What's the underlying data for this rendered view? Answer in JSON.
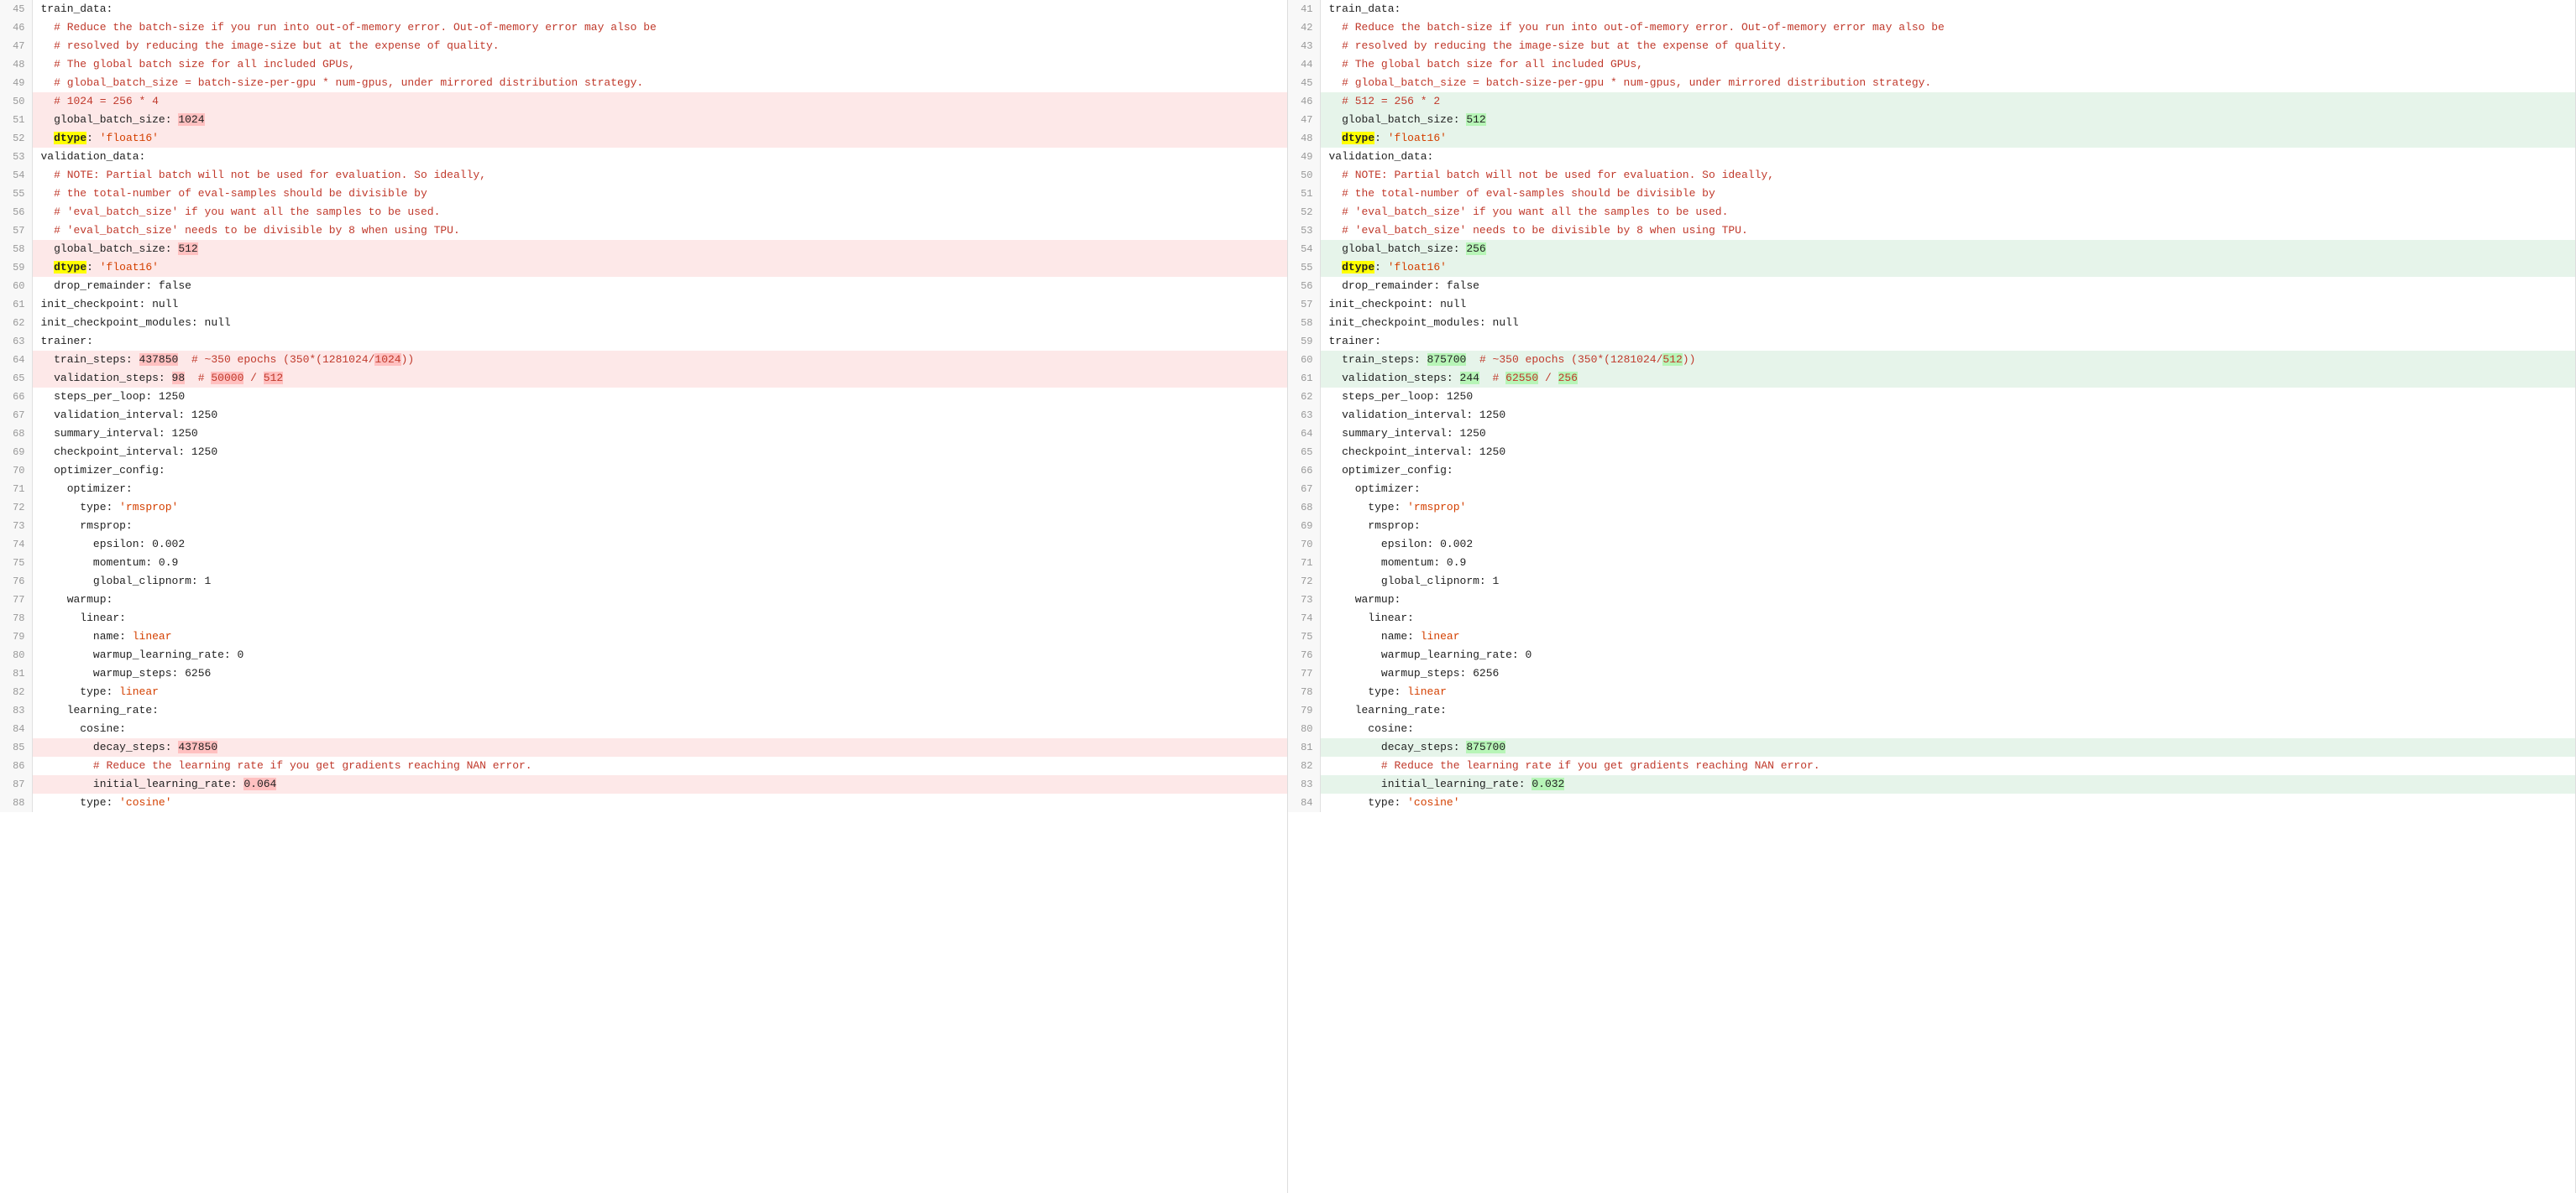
{
  "panes": [
    {
      "id": "left",
      "lines": [
        {
          "n": 45,
          "code": "train_data:",
          "bg": ""
        },
        {
          "n": 46,
          "code": "  # Reduce the batch-size if you run into out-of-memory error. Out-of-memory error may also be",
          "bg": ""
        },
        {
          "n": 47,
          "code": "  # resolved by reducing the image-size but at the expense of quality.",
          "bg": ""
        },
        {
          "n": 48,
          "code": "  # The global batch size for all included GPUs,",
          "bg": ""
        },
        {
          "n": 49,
          "code": "  # global_batch_size = batch-size-per-gpu * num-gpus, under mirrored distribution strategy.",
          "bg": ""
        },
        {
          "n": 50,
          "code": "  # 1024 = 256 * 4",
          "bg": "pink"
        },
        {
          "n": 51,
          "code": "  global_batch_size: 1024",
          "bg": "pink"
        },
        {
          "n": 52,
          "code": "  dtype: 'float16'",
          "bg": "pink"
        },
        {
          "n": 53,
          "code": "validation_data:",
          "bg": ""
        },
        {
          "n": 54,
          "code": "  # NOTE: Partial batch will not be used for evaluation. So ideally,",
          "bg": ""
        },
        {
          "n": 55,
          "code": "  # the total-number of eval-samples should be divisible by",
          "bg": ""
        },
        {
          "n": 56,
          "code": "  # 'eval_batch_size' if you want all the samples to be used.",
          "bg": ""
        },
        {
          "n": 57,
          "code": "  # 'eval_batch_size' needs to be divisible by 8 when using TPU.",
          "bg": ""
        },
        {
          "n": 58,
          "code": "  global_batch_size: 512",
          "bg": "pink"
        },
        {
          "n": 59,
          "code": "  dtype: 'float16'",
          "bg": "pink"
        },
        {
          "n": 60,
          "code": "  drop_remainder: false",
          "bg": ""
        },
        {
          "n": 61,
          "code": "init_checkpoint: null",
          "bg": ""
        },
        {
          "n": 62,
          "code": "init_checkpoint_modules: null",
          "bg": ""
        },
        {
          "n": 63,
          "code": "trainer:",
          "bg": ""
        },
        {
          "n": 64,
          "code": "  train_steps: 437850  # ~350 epochs (350*(1281024/1024))",
          "bg": "pink"
        },
        {
          "n": 65,
          "code": "  validation_steps: 98  # 50000 / 512",
          "bg": "pink"
        },
        {
          "n": 66,
          "code": "  steps_per_loop: 1250",
          "bg": ""
        },
        {
          "n": 67,
          "code": "  validation_interval: 1250",
          "bg": ""
        },
        {
          "n": 68,
          "code": "  summary_interval: 1250",
          "bg": ""
        },
        {
          "n": 69,
          "code": "  checkpoint_interval: 1250",
          "bg": ""
        },
        {
          "n": 70,
          "code": "  optimizer_config:",
          "bg": ""
        },
        {
          "n": 71,
          "code": "    optimizer:",
          "bg": ""
        },
        {
          "n": 72,
          "code": "      type: 'rmsprop'",
          "bg": ""
        },
        {
          "n": 73,
          "code": "      rmsprop:",
          "bg": ""
        },
        {
          "n": 74,
          "code": "        epsilon: 0.002",
          "bg": ""
        },
        {
          "n": 75,
          "code": "        momentum: 0.9",
          "bg": ""
        },
        {
          "n": 76,
          "code": "        global_clipnorm: 1",
          "bg": ""
        },
        {
          "n": 77,
          "code": "    warmup:",
          "bg": ""
        },
        {
          "n": 78,
          "code": "      linear:",
          "bg": ""
        },
        {
          "n": 79,
          "code": "        name: linear",
          "bg": ""
        },
        {
          "n": 80,
          "code": "        warmup_learning_rate: 0",
          "bg": ""
        },
        {
          "n": 81,
          "code": "        warmup_steps: 6256",
          "bg": ""
        },
        {
          "n": 82,
          "code": "      type: linear",
          "bg": ""
        },
        {
          "n": 83,
          "code": "    learning_rate:",
          "bg": ""
        },
        {
          "n": 84,
          "code": "      cosine:",
          "bg": ""
        },
        {
          "n": 85,
          "code": "        decay_steps: 437850",
          "bg": "pink"
        },
        {
          "n": 86,
          "code": "        # Reduce the learning rate if you get gradients reaching NAN error.",
          "bg": ""
        },
        {
          "n": 87,
          "code": "        initial_learning_rate: 0.064",
          "bg": "pink"
        },
        {
          "n": 88,
          "code": "      type: 'cosine'",
          "bg": ""
        }
      ]
    },
    {
      "id": "right",
      "lines": [
        {
          "n": 41,
          "code": "train_data:",
          "bg": ""
        },
        {
          "n": 42,
          "code": "  # Reduce the batch-size if you run into out-of-memory error. Out-of-memory error may also be",
          "bg": ""
        },
        {
          "n": 43,
          "code": "  # resolved by reducing the image-size but at the expense of quality.",
          "bg": ""
        },
        {
          "n": 44,
          "code": "  # The global batch size for all included GPUs,",
          "bg": ""
        },
        {
          "n": 45,
          "code": "  # global_batch_size = batch-size-per-gpu * num-gpus, under mirrored distribution strategy.",
          "bg": ""
        },
        {
          "n": 46,
          "code": "  # 512 = 256 * 2",
          "bg": "green"
        },
        {
          "n": 47,
          "code": "  global_batch_size: 512",
          "bg": "green"
        },
        {
          "n": 48,
          "code": "  dtype: 'float16'",
          "bg": "green"
        },
        {
          "n": 49,
          "code": "validation_data:",
          "bg": ""
        },
        {
          "n": 50,
          "code": "  # NOTE: Partial batch will not be used for evaluation. So ideally,",
          "bg": ""
        },
        {
          "n": 51,
          "code": "  # the total-number of eval-samples should be divisible by",
          "bg": ""
        },
        {
          "n": 52,
          "code": "  # 'eval_batch_size' if you want all the samples to be used.",
          "bg": ""
        },
        {
          "n": 53,
          "code": "  # 'eval_batch_size' needs to be divisible by 8 when using TPU.",
          "bg": ""
        },
        {
          "n": 54,
          "code": "  global_batch_size: 256",
          "bg": "green"
        },
        {
          "n": 55,
          "code": "  dtype: 'float16'",
          "bg": "green"
        },
        {
          "n": 56,
          "code": "  drop_remainder: false",
          "bg": ""
        },
        {
          "n": 57,
          "code": "init_checkpoint: null",
          "bg": ""
        },
        {
          "n": 58,
          "code": "init_checkpoint_modules: null",
          "bg": ""
        },
        {
          "n": 59,
          "code": "trainer:",
          "bg": ""
        },
        {
          "n": 60,
          "code": "  train_steps: 875700  # ~350 epochs (350*(1281024/512))",
          "bg": "green"
        },
        {
          "n": 61,
          "code": "  validation_steps: 244  # 62550 / 256",
          "bg": "green"
        },
        {
          "n": 62,
          "code": "  steps_per_loop: 1250",
          "bg": ""
        },
        {
          "n": 63,
          "code": "  validation_interval: 1250",
          "bg": ""
        },
        {
          "n": 64,
          "code": "  summary_interval: 1250",
          "bg": ""
        },
        {
          "n": 65,
          "code": "  checkpoint_interval: 1250",
          "bg": ""
        },
        {
          "n": 66,
          "code": "  optimizer_config:",
          "bg": ""
        },
        {
          "n": 67,
          "code": "    optimizer:",
          "bg": ""
        },
        {
          "n": 68,
          "code": "      type: 'rmsprop'",
          "bg": ""
        },
        {
          "n": 69,
          "code": "      rmsprop:",
          "bg": ""
        },
        {
          "n": 70,
          "code": "        epsilon: 0.002",
          "bg": ""
        },
        {
          "n": 71,
          "code": "        momentum: 0.9",
          "bg": ""
        },
        {
          "n": 72,
          "code": "        global_clipnorm: 1",
          "bg": ""
        },
        {
          "n": 73,
          "code": "    warmup:",
          "bg": ""
        },
        {
          "n": 74,
          "code": "      linear:",
          "bg": ""
        },
        {
          "n": 75,
          "code": "        name: linear",
          "bg": ""
        },
        {
          "n": 76,
          "code": "        warmup_learning_rate: 0",
          "bg": ""
        },
        {
          "n": 77,
          "code": "        warmup_steps: 6256",
          "bg": ""
        },
        {
          "n": 78,
          "code": "      type: linear",
          "bg": ""
        },
        {
          "n": 79,
          "code": "    learning_rate:",
          "bg": ""
        },
        {
          "n": 80,
          "code": "      cosine:",
          "bg": ""
        },
        {
          "n": 81,
          "code": "        decay_steps: 875700",
          "bg": "green"
        },
        {
          "n": 82,
          "code": "        # Reduce the learning rate if you get gradients reaching NAN error.",
          "bg": ""
        },
        {
          "n": 83,
          "code": "        initial_learning_rate: 0.032",
          "bg": "green"
        },
        {
          "n": 84,
          "code": "      type: 'cosine'",
          "bg": ""
        }
      ]
    }
  ]
}
